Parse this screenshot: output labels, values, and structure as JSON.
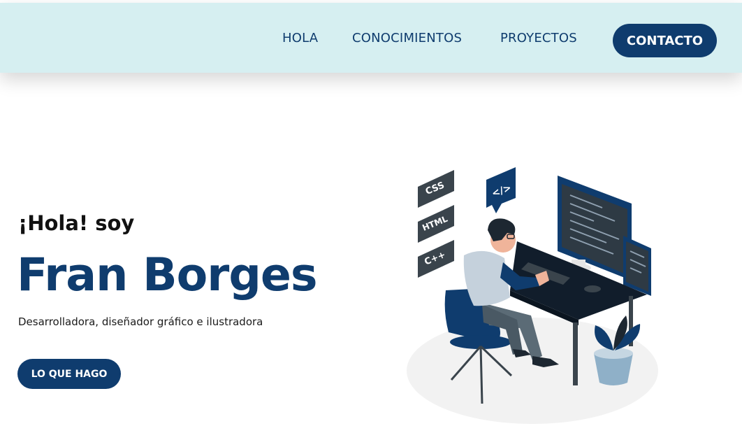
{
  "nav": {
    "items": [
      {
        "label": "HOLA"
      },
      {
        "label": "CONOCIMIENTOS"
      },
      {
        "label": "PROYECTOS"
      }
    ],
    "contact_label": "CONTACTO"
  },
  "hero": {
    "greeting": "¡Hola! soy",
    "name": "Fran Borges",
    "subtitle": "Desarrolladora, diseñador gráfico e ilustradora",
    "cta_label": "LO QUE HAGO"
  },
  "illustration": {
    "badges": [
      "CSS",
      "HTML",
      "C++"
    ],
    "code_icon_label": "</>"
  },
  "colors": {
    "navbar_bg": "#d6eff1",
    "primary": "#0f3c6e",
    "text_dark": "#111111"
  }
}
